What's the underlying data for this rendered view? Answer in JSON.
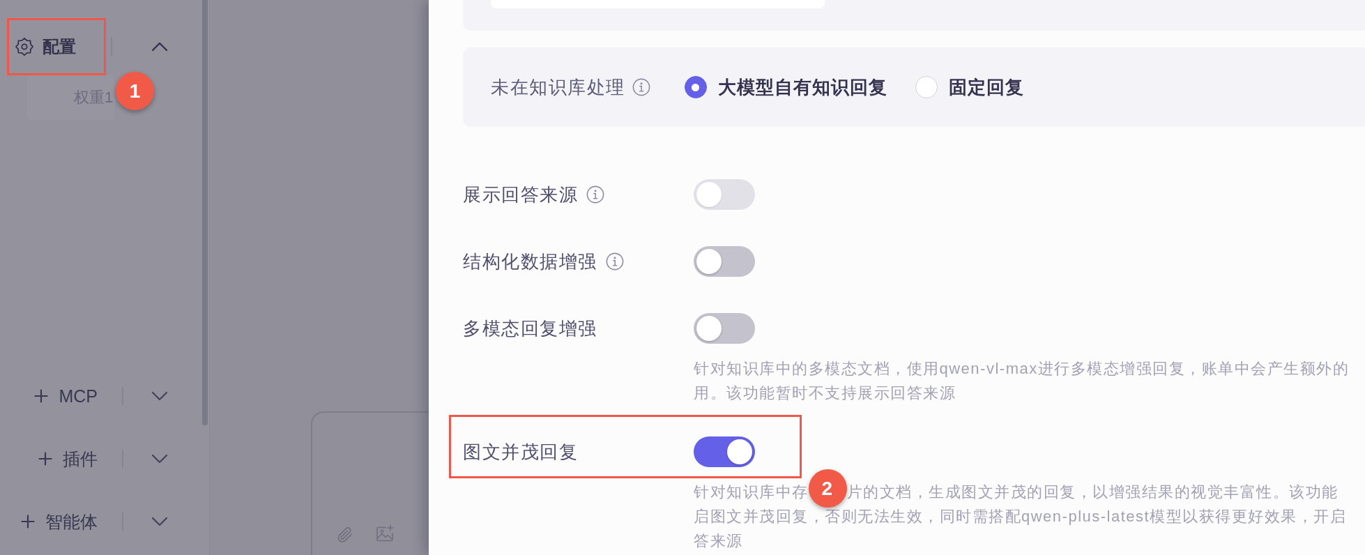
{
  "sidebar": {
    "config": {
      "label": "配置",
      "expanded": true,
      "highlighted": true,
      "callout": "1"
    },
    "weight": "权重1",
    "sections": [
      {
        "label": "MCP",
        "expanded": false
      },
      {
        "label": "插件",
        "expanded": false
      },
      {
        "label": "智能体",
        "expanded": false
      }
    ]
  },
  "settings": {
    "fallback": {
      "label": "未在知识库处理",
      "info": true,
      "options": [
        {
          "label": "大模型自有知识回复",
          "selected": true
        },
        {
          "label": "固定回复",
          "selected": false
        }
      ]
    },
    "toggles": [
      {
        "label": "展示回答来源",
        "info": true,
        "on": false,
        "disabled": true,
        "highlighted": false
      },
      {
        "label": "结构化数据增强",
        "info": true,
        "on": false,
        "disabled": false,
        "highlighted": false
      },
      {
        "label": "多模态回复增强",
        "info": false,
        "on": false,
        "disabled": false,
        "highlighted": false,
        "description": [
          [
            "针对知识库中的多模态文档，使用qwen-vl-max进行多模态增强回复，账单中会产生额外的"
          ],
          [
            "用。该功能暂时不支持展示回答来源"
          ]
        ]
      },
      {
        "label": "图文并茂回复",
        "info": false,
        "on": true,
        "disabled": false,
        "highlighted": true,
        "callout": "2",
        "description": [
          [
            "针对知识库中存",
            "片的文档，生成图文并茂的回复，以增强结果的视觉丰富性。该功能"
          ],
          [
            "启图文并茂回复，否则无法生效，同时需搭配qwen-plus-latest模型以获得更好效果，开启"
          ],
          [
            "答来源"
          ]
        ]
      }
    ]
  }
}
